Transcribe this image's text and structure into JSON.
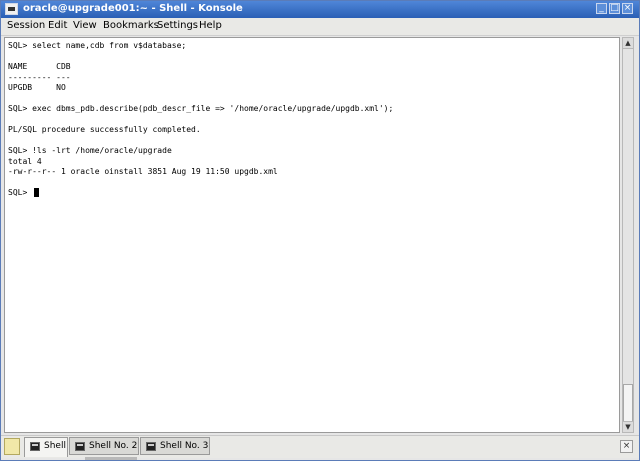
{
  "window": {
    "title": "oracle@upgrade001:~ - Shell - Konsole",
    "controls": {
      "minimize": "_",
      "maximize": "□",
      "close": "×"
    }
  },
  "menu": {
    "items": [
      "Session",
      "Edit",
      "View",
      "Bookmarks",
      "Settings",
      "Help"
    ]
  },
  "terminal": {
    "lines": [
      "SQL> select name,cdb from v$database;",
      "",
      "NAME      CDB",
      "--------- ---",
      "UPGDB     NO",
      "",
      "SQL> exec dbms_pdb.describe(pdb_descr_file => '/home/oracle/upgrade/upgdb.xml');",
      "",
      "PL/SQL procedure successfully completed.",
      "",
      "SQL> !ls -lrt /home/oracle/upgrade",
      "total 4",
      "-rw-r--r-- 1 oracle oinstall 3851 Aug 19 11:50 upgdb.xml",
      "",
      "SQL> "
    ]
  },
  "tabs": [
    {
      "label": "Shell",
      "active": true
    },
    {
      "label": "Shell No. 2",
      "active": false
    },
    {
      "label": "Shell No. 3",
      "active": false
    }
  ],
  "icons": {
    "app": "terminal-icon",
    "new_tab": "new-tab-icon",
    "tab": "terminal-tab-icon",
    "close_tab": "close-tab-icon"
  },
  "colors": {
    "titlebar": "#2a5fb5",
    "terminal_bg": "#ffffff",
    "terminal_fg": "#000000"
  }
}
